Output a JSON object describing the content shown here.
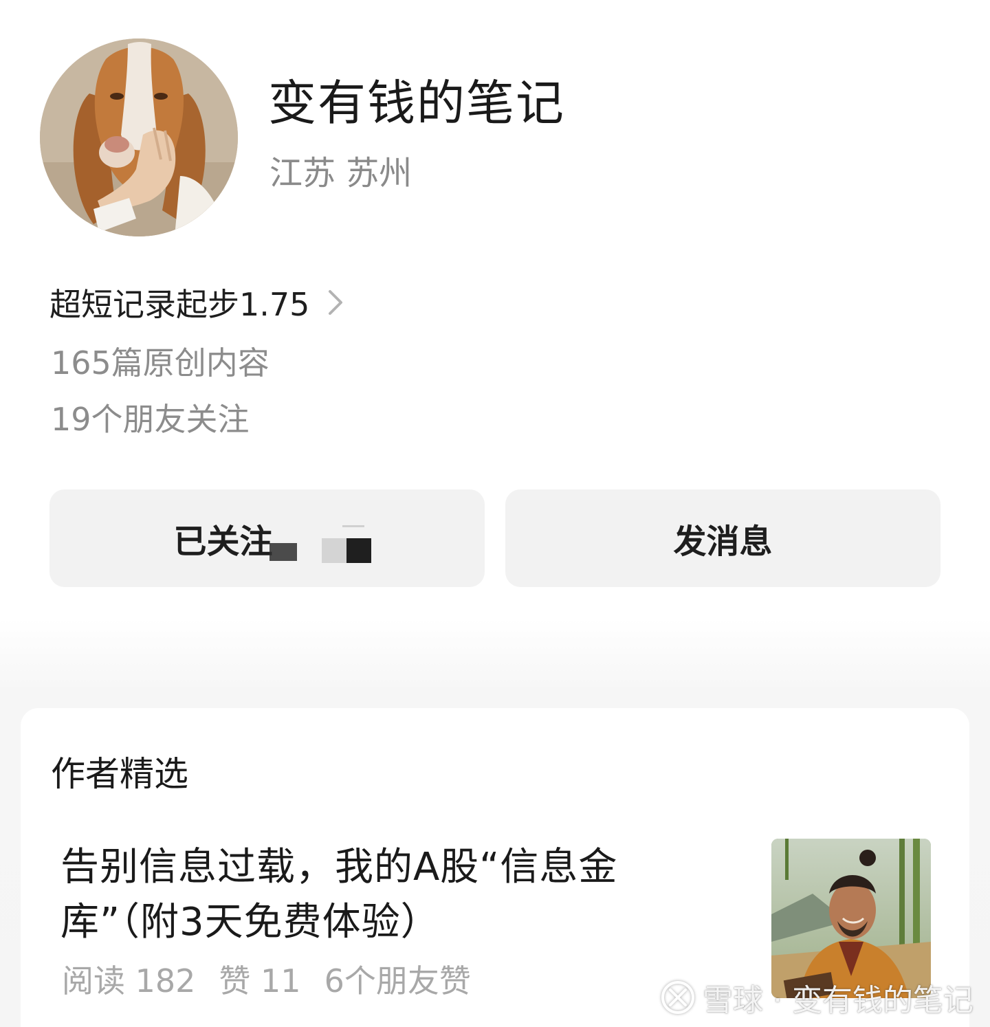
{
  "profile": {
    "name": "变有钱的笔记",
    "location": "江苏 苏州",
    "intro": "超短记录起步1.75",
    "articles_count_text": "165篇原创内容",
    "friends_following_text": "19个朋友关注"
  },
  "actions": {
    "following_label": "已关注",
    "message_label": "发消息"
  },
  "featured": {
    "section_title": "作者精选",
    "articles": [
      {
        "title": "告别信息过载，我的A股“信息金库”（附3天免费体验）",
        "reads": "阅读 182",
        "likes": "赞 11",
        "friend_likes": "6个朋友赞"
      }
    ]
  },
  "watermark": {
    "text": "雪球 · 变有钱的笔记"
  }
}
